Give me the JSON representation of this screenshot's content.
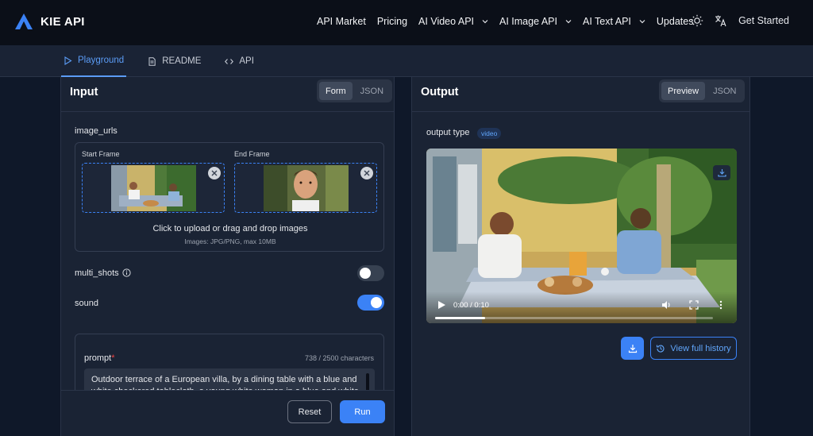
{
  "brand": {
    "name": "KIE API",
    "accent": "#3b82f6"
  },
  "nav": {
    "items": [
      {
        "label": "API Market",
        "dropdown": false
      },
      {
        "label": "Pricing",
        "dropdown": false
      },
      {
        "label": "AI Video API",
        "dropdown": true
      },
      {
        "label": "AI Image API",
        "dropdown": true
      },
      {
        "label": "AI Text API",
        "dropdown": true
      },
      {
        "label": "Updates",
        "dropdown": false
      }
    ],
    "theme_icon": "sun-icon",
    "language_icon": "translate-icon",
    "cta": "Get Started"
  },
  "subnav": {
    "tabs": [
      {
        "label": "Playground",
        "icon": "play-icon",
        "active": true
      },
      {
        "label": "README",
        "icon": "document-icon",
        "active": false
      },
      {
        "label": "API",
        "icon": "code-icon",
        "active": false
      }
    ]
  },
  "input": {
    "title": "Input",
    "modes": [
      "Form",
      "JSON"
    ],
    "active_mode": "Form",
    "image_urls": {
      "label": "image_urls",
      "start_frame_label": "Start Frame",
      "end_frame_label": "End Frame",
      "upload_text": "Click to upload or drag and drop images",
      "upload_hint": "Images: JPG/PNG, max 10MB"
    },
    "multi_shots": {
      "label": "multi_shots",
      "enabled": false
    },
    "sound": {
      "label": "sound",
      "enabled": true
    },
    "prompt": {
      "label": "prompt",
      "required_mark": "*",
      "count": "738 / 2500 characters",
      "value": "Outdoor terrace of a European villa, by a dining table with a blue and white checkered tablecloth, a young white woman in a blue and white"
    },
    "reset_label": "Reset",
    "run_label": "Run"
  },
  "output": {
    "title": "Output",
    "modes": [
      "Preview",
      "JSON"
    ],
    "active_mode": "Preview",
    "output_type_label": "output type",
    "output_type_value": "video",
    "video": {
      "time": "0:00 / 0:10",
      "progress": 0.18
    },
    "history_label": "View full history"
  }
}
